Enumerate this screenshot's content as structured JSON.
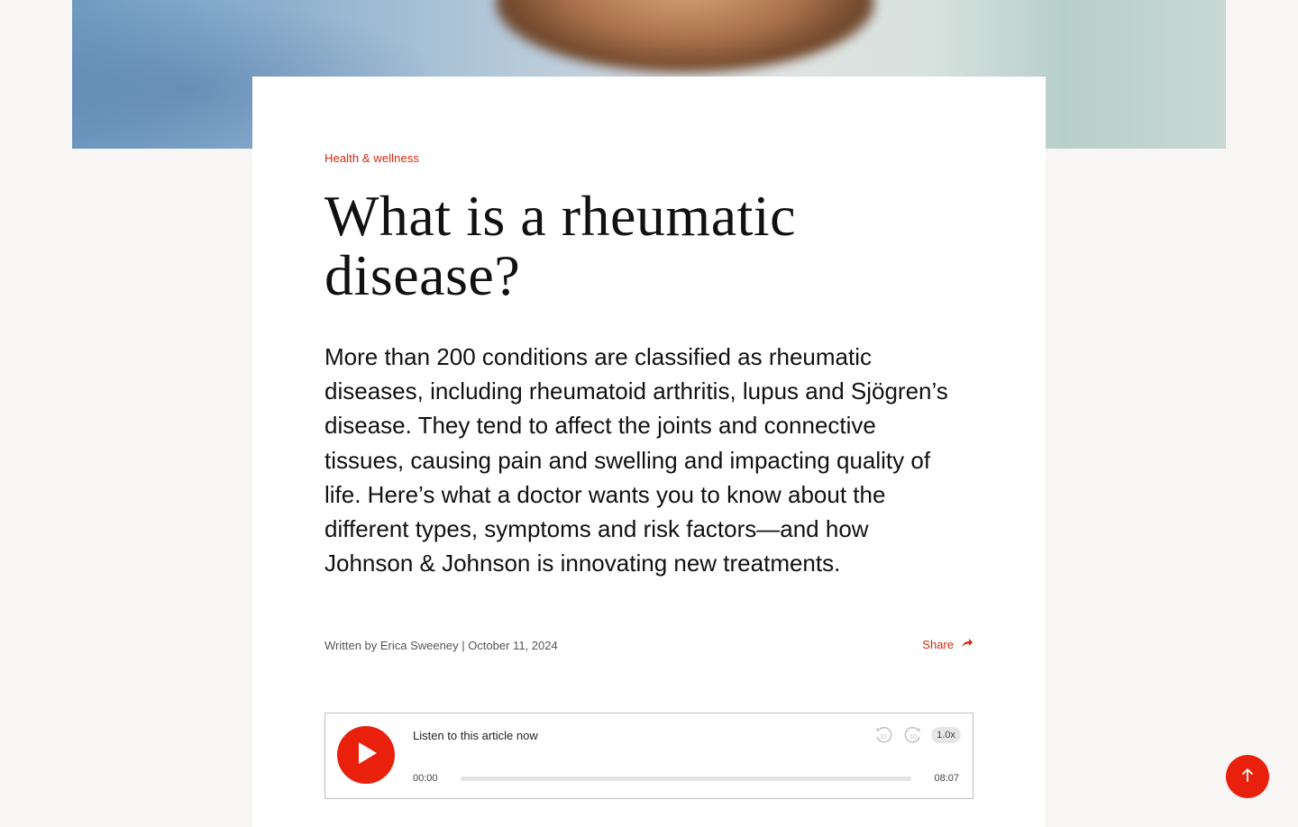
{
  "article": {
    "category": "Health & wellness",
    "title_line1": "What is a rheumatic",
    "title_line2": "disease?",
    "lede": "More than 200 conditions are classified as rheumatic diseases, including rheumatoid arthritis, lupus and Sjögren’s disease. They tend to affect the joints and connective tissues, causing pain and swelling and impacting quality of life. Here’s what a doctor wants you to know about the different types, symptoms and risk factors—and how Johnson & Johnson is innovating new treatments.",
    "byline": "Written by Erica Sweeney | October 11, 2024",
    "share_label": "Share"
  },
  "player": {
    "title": "Listen to this article now",
    "current_time": "00:00",
    "total_time": "08:07",
    "speed": "1.0x",
    "progress": 0,
    "rewind_seconds": "10",
    "forward_seconds": "10"
  },
  "colors": {
    "accent": "#e8200c",
    "link": "#d5280f",
    "page_bg": "#f7f6f4",
    "card_bg": "#ffffff"
  },
  "icons": {
    "play": "play-icon",
    "rewind": "rewind-10-icon",
    "forward": "forward-10-icon",
    "share": "share-arrow-icon",
    "back_to_top": "arrow-up-icon"
  }
}
